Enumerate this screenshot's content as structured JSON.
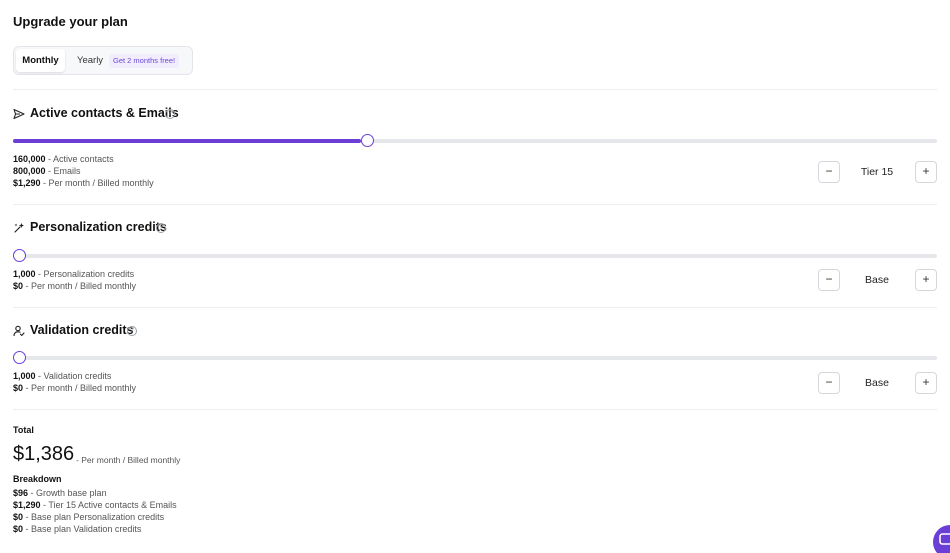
{
  "page": {
    "title": "Upgrade your plan"
  },
  "billing_toggle": {
    "monthly": "Monthly",
    "yearly": "Yearly",
    "promo": "Get 2 months free!",
    "selected": "Monthly"
  },
  "sections": {
    "contacts": {
      "title": "Active contacts & Emails",
      "icon": "send-icon",
      "slider_fraction": 0.377,
      "lines": [
        {
          "value": "160,000",
          "text": " - Active contacts"
        },
        {
          "value": "800,000",
          "text": " - Emails"
        },
        {
          "value": "$1,290",
          "text": " - Per month / Billed monthly"
        }
      ],
      "tier": "Tier 15",
      "minus": "−",
      "plus": "+"
    },
    "personalization": {
      "title": "Personalization credits",
      "icon": "sparkle-wand-icon",
      "slider_fraction": 0.0,
      "lines": [
        {
          "value": "1,000",
          "text": " - Personalization credits"
        },
        {
          "value": "$0",
          "text": " - Per month / Billed monthly"
        }
      ],
      "tier": "Base",
      "minus": "−",
      "plus": "+"
    },
    "validation": {
      "title": "Validation credits",
      "icon": "user-check-icon",
      "slider_fraction": 0.0,
      "lines": [
        {
          "value": "1,000",
          "text": " - Validation credits"
        },
        {
          "value": "$0",
          "text": " - Per month / Billed monthly"
        }
      ],
      "tier": "Base",
      "minus": "−",
      "plus": "+"
    }
  },
  "total": {
    "label": "Total",
    "amount": "$1,386",
    "suffix": "- Per month / Billed monthly",
    "breakdown_label": "Breakdown",
    "breakdown": [
      {
        "value": "$96",
        "text": " - Growth base plan"
      },
      {
        "value": "$1,290",
        "text": " - Tier 15 Active contacts & Emails"
      },
      {
        "value": "$0",
        "text": " - Base plan Personalization credits"
      },
      {
        "value": "$0",
        "text": " - Base plan Validation credits"
      }
    ]
  },
  "colors": {
    "accent": "#6b3fd6",
    "track": "#e6e7ea",
    "promo_bg": "#f1edfd"
  }
}
